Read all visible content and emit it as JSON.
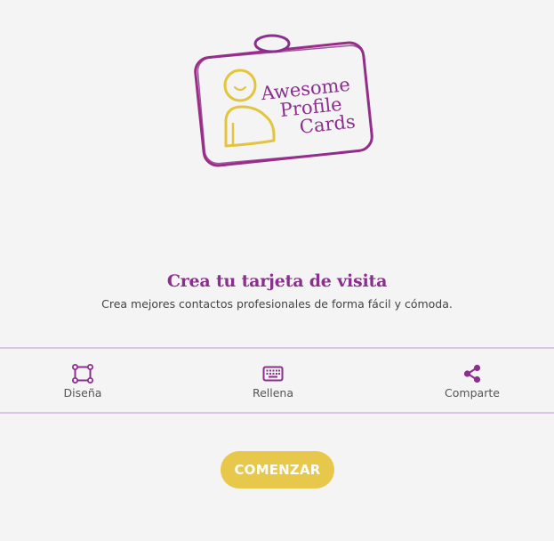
{
  "logo": {
    "line1": "Awesome",
    "line2": "Profile",
    "line3": "Cards",
    "icon": "badge-person-icon",
    "colors": {
      "purple": "#8a2f8e",
      "gold": "#e3c43c"
    }
  },
  "hero": {
    "title": "Crea tu tarjeta de visita",
    "subtitle": "Crea mejores contactos profesionales de forma fácil y cómoda."
  },
  "steps": [
    {
      "icon": "design-frame-icon",
      "label": "Diseña"
    },
    {
      "icon": "keyboard-icon",
      "label": "Rellena"
    },
    {
      "icon": "share-icon",
      "label": "Comparte"
    }
  ],
  "cta": {
    "label": "COMENZAR"
  },
  "colors": {
    "accent": "#8a2f8e",
    "button": "#e8c84a",
    "divider": "#dcc2e3",
    "background": "#f4f4f4"
  }
}
